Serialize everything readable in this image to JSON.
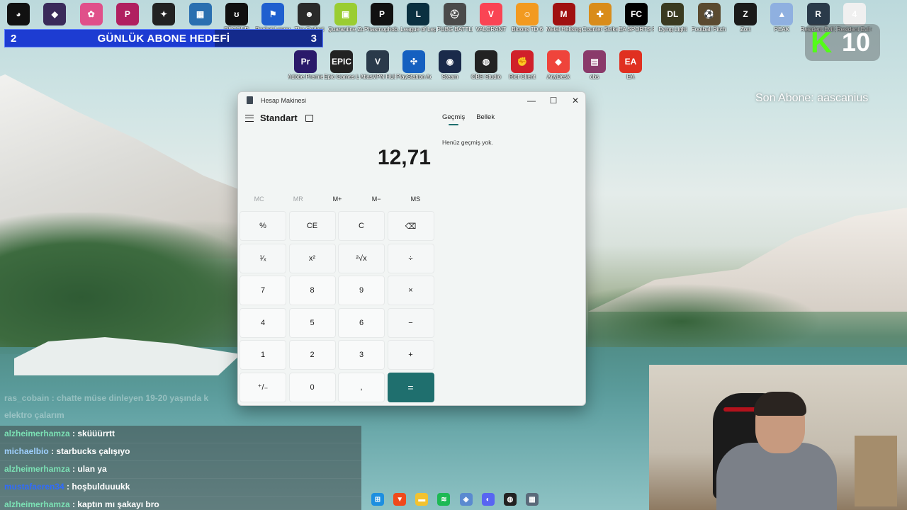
{
  "desktop_icons_row1": [
    {
      "label": "",
      "color": "#111111",
      "glyph": "◕"
    },
    {
      "label": "",
      "color": "#3a2a5a",
      "glyph": "◆"
    },
    {
      "label": "",
      "color": "#e0508a",
      "glyph": "✿"
    },
    {
      "label": "",
      "color": "#b02060",
      "glyph": "P"
    },
    {
      "label": "",
      "color": "#222222",
      "glyph": "✦"
    },
    {
      "label": "",
      "color": "#2a6fb0",
      "glyph": "▦"
    },
    {
      "label": "DECOUR",
      "color": "#101010",
      "glyph": "ʊ"
    },
    {
      "label": "Rocket League",
      "color": "#1f5fcf",
      "glyph": "⚑"
    },
    {
      "label": "The Outlast",
      "color": "#2a2a2a",
      "glyph": "☻"
    },
    {
      "label": "Quarantine Zone The...",
      "color": "#9acd32",
      "glyph": "▣"
    },
    {
      "label": "Phasmophob...",
      "color": "#111111",
      "glyph": "P"
    },
    {
      "label": "League of Legends",
      "color": "#0a3040",
      "glyph": "L"
    },
    {
      "label": "PUBG BATTLEGR...",
      "color": "#4a4a4a",
      "glyph": "⛑"
    },
    {
      "label": "VALORANT",
      "color": "#fa4454",
      "glyph": "V"
    },
    {
      "label": "Bloons TD 6",
      "color": "#f29a20",
      "glyph": "☺"
    },
    {
      "label": "Metal Hellsinger",
      "color": "#a01010",
      "glyph": "M"
    },
    {
      "label": "Counter Strike 2",
      "color": "#d98c1a",
      "glyph": "✚"
    },
    {
      "label": "EA SPORTS FC 25",
      "color": "#000000",
      "glyph": "FC"
    },
    {
      "label": "Dying Light",
      "color": "#3a3a20",
      "glyph": "DL"
    },
    {
      "label": "Football Pitch Si...",
      "color": "#5a4a30",
      "glyph": "⚽"
    },
    {
      "label": "Zort",
      "color": "#1a1a1a",
      "glyph": "Z"
    },
    {
      "label": "PEAK",
      "color": "#8fb0e0",
      "glyph": "▲"
    },
    {
      "label": "Resident Evil 2",
      "color": "#2a3a4a",
      "glyph": "R"
    },
    {
      "label": "Resident Evil 4",
      "color": "#f0f0f0",
      "glyph": "4"
    }
  ],
  "desktop_icons_row2": [
    {
      "label": "Adobe Premiere P...",
      "color": "#2a1a6a",
      "glyph": "Pr"
    },
    {
      "label": "Epic Games Launcher",
      "color": "#222222",
      "glyph": "EPIC"
    },
    {
      "label": "AtlasVPN HUB",
      "color": "#2a3a4a",
      "glyph": "V"
    },
    {
      "label": "PlayStation Accessories",
      "color": "#1560c0",
      "glyph": "✣"
    },
    {
      "label": "Steam",
      "color": "#1a2a4a",
      "glyph": "◉"
    },
    {
      "label": "OBS Studio",
      "color": "#222222",
      "glyph": "◍"
    },
    {
      "label": "Riot Client",
      "color": "#d0202a",
      "glyph": "✊"
    },
    {
      "label": "AnyDesk",
      "color": "#ef443b",
      "glyph": "◆"
    },
    {
      "label": "cbs",
      "color": "#8a3a6a",
      "glyph": "▤"
    },
    {
      "label": "EA",
      "color": "#e03020",
      "glyph": "EA"
    }
  ],
  "overlay": {
    "goal_left_count": "2",
    "goal_title": "GÜNLÜK ABONE HEDEFİ",
    "goal_right_count": "3",
    "goal_progress": 0.66,
    "kick_count": "10",
    "kick_logo": "K",
    "last_sub": "Son Abone: aascanius"
  },
  "calculator": {
    "window_title": "Hesap Makinesi",
    "mode": "Standart",
    "display_value": "12,71",
    "tab_history": "Geçmiş",
    "tab_memory": "Bellek",
    "history_empty": "Henüz geçmiş yok.",
    "memory_buttons": [
      {
        "label": "MC",
        "enabled": false
      },
      {
        "label": "MR",
        "enabled": false
      },
      {
        "label": "M+",
        "enabled": true
      },
      {
        "label": "M−",
        "enabled": true
      },
      {
        "label": "MS",
        "enabled": true
      }
    ],
    "keys": [
      {
        "label": "%",
        "name": "percent-key",
        "type": "op"
      },
      {
        "label": "CE",
        "name": "clear-entry-key",
        "type": "op"
      },
      {
        "label": "C",
        "name": "clear-key",
        "type": "op"
      },
      {
        "label": "⌫",
        "name": "backspace-key",
        "type": "op"
      },
      {
        "label": "¹⁄ₓ",
        "name": "reciprocal-key",
        "type": "op"
      },
      {
        "label": "x²",
        "name": "square-key",
        "type": "op"
      },
      {
        "label": "²√x",
        "name": "square-root-key",
        "type": "op"
      },
      {
        "label": "÷",
        "name": "divide-key",
        "type": "op"
      },
      {
        "label": "7",
        "name": "digit-7-key",
        "type": "num"
      },
      {
        "label": "8",
        "name": "digit-8-key",
        "type": "num"
      },
      {
        "label": "9",
        "name": "digit-9-key",
        "type": "num"
      },
      {
        "label": "×",
        "name": "multiply-key",
        "type": "op"
      },
      {
        "label": "4",
        "name": "digit-4-key",
        "type": "num"
      },
      {
        "label": "5",
        "name": "digit-5-key",
        "type": "num"
      },
      {
        "label": "6",
        "name": "digit-6-key",
        "type": "num"
      },
      {
        "label": "−",
        "name": "subtract-key",
        "type": "op"
      },
      {
        "label": "1",
        "name": "digit-1-key",
        "type": "num"
      },
      {
        "label": "2",
        "name": "digit-2-key",
        "type": "num"
      },
      {
        "label": "3",
        "name": "digit-3-key",
        "type": "num"
      },
      {
        "label": "+",
        "name": "add-key",
        "type": "op"
      },
      {
        "label": "⁺/₋",
        "name": "negate-key",
        "type": "num"
      },
      {
        "label": "0",
        "name": "digit-0-key",
        "type": "num"
      },
      {
        "label": ",",
        "name": "decimal-key",
        "type": "num"
      },
      {
        "label": "=",
        "name": "equals-key",
        "type": "eq"
      }
    ],
    "accent": "#1f6f6e"
  },
  "chat": {
    "faded_lines": [
      "ras_cobain : chatte müse dinleyen 19-20 yaşında k",
      "elektro çalarım"
    ],
    "messages": [
      {
        "user": "alzheimerhamza",
        "text": " : sküüürrtt",
        "color": "c1"
      },
      {
        "user": "michaelbio",
        "text": " : starbucks çalışıyo",
        "color": "c2"
      },
      {
        "user": "alzheimerhamza",
        "text": " : ulan ya",
        "color": "c1"
      },
      {
        "user": "mustafaeren34",
        "text": " : hoşbulduuukk",
        "color": "c3"
      },
      {
        "user": "alzheimerhamza",
        "text": " : kaptın mı şakayı bro",
        "color": "c1"
      }
    ]
  },
  "taskbar": [
    {
      "name": "windows-start-icon",
      "color": "#1d8fe0",
      "glyph": "⊞"
    },
    {
      "name": "brave-browser-icon",
      "color": "#f04a1c",
      "glyph": "▼"
    },
    {
      "name": "file-explorer-icon",
      "color": "#f2c230",
      "glyph": "▬"
    },
    {
      "name": "spotify-icon",
      "color": "#1db954",
      "glyph": "≋"
    },
    {
      "name": "app-icon",
      "color": "#5a8ad0",
      "glyph": "◈"
    },
    {
      "name": "discord-icon",
      "color": "#5865f2",
      "glyph": "◐"
    },
    {
      "name": "obs-icon",
      "color": "#222222",
      "glyph": "◍"
    },
    {
      "name": "calculator-icon",
      "color": "#5a6a7a",
      "glyph": "▦"
    }
  ]
}
